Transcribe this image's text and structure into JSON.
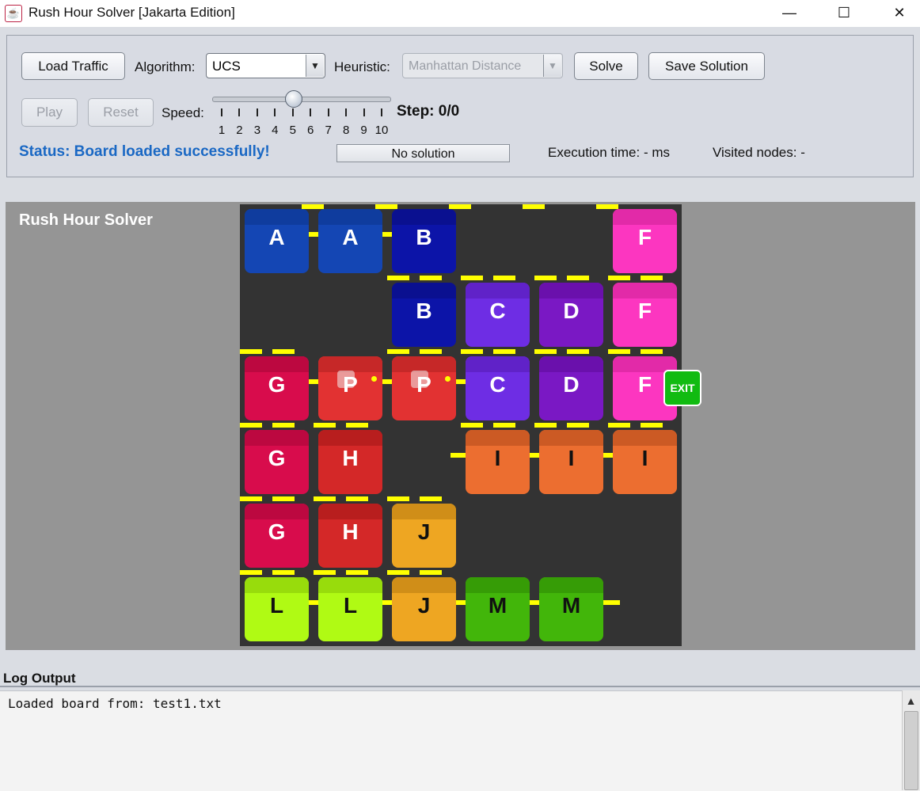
{
  "window": {
    "title": "Rush Hour Solver [Jakarta Edition]",
    "icon": "java-cup-icon"
  },
  "window_controls": {
    "minimize": "—",
    "maximize": "☐",
    "close": "✕"
  },
  "toolbar": {
    "load_label": "Load Traffic",
    "algorithm_label": "Algorithm:",
    "algorithm_value": "UCS",
    "heuristic_label": "Heuristic:",
    "heuristic_value": "Manhattan Distance",
    "solve_label": "Solve",
    "save_label": "Save Solution",
    "play_label": "Play",
    "reset_label": "Reset",
    "speed_label": "Speed:",
    "speed_ticks": [
      "1",
      "2",
      "3",
      "4",
      "5",
      "6",
      "7",
      "8",
      "9",
      "10"
    ],
    "speed_value": 5,
    "step": "Step: 0/0",
    "status": "Status: Board loaded successfully!",
    "progress_text": "No solution",
    "exec_time": "Execution time: - ms",
    "visited_nodes": "Visited nodes: -"
  },
  "board": {
    "title": "Rush Hour Solver",
    "exit_label": "EXIT",
    "rows": 6,
    "cols": 6,
    "pieces": [
      {
        "id": "A",
        "cells": [
          [
            0,
            0
          ],
          [
            0,
            1
          ]
        ],
        "color": "#1446b4",
        "top": "#0f3c9e",
        "text": "#ffffff"
      },
      {
        "id": "B",
        "cells": [
          [
            0,
            2
          ],
          [
            1,
            2
          ]
        ],
        "color": "#0c14a8",
        "top": "#0a1090",
        "text": "#ffffff"
      },
      {
        "id": "F",
        "cells": [
          [
            0,
            5
          ],
          [
            1,
            5
          ],
          [
            2,
            5
          ]
        ],
        "color": "#fc36c0",
        "top": "#e22aa8",
        "text": "#ffffff"
      },
      {
        "id": "C",
        "cells": [
          [
            1,
            3
          ],
          [
            2,
            3
          ]
        ],
        "color": "#6e2de4",
        "top": "#6022c8",
        "text": "#ffffff"
      },
      {
        "id": "D",
        "cells": [
          [
            1,
            4
          ],
          [
            2,
            4
          ]
        ],
        "color": "#7a18c4",
        "top": "#6a10ac",
        "text": "#ffffff"
      },
      {
        "id": "G",
        "cells": [
          [
            2,
            0
          ],
          [
            3,
            0
          ],
          [
            4,
            0
          ]
        ],
        "color": "#d80c4c",
        "top": "#bc0840",
        "text": "#ffffff"
      },
      {
        "id": "P",
        "cells": [
          [
            2,
            1
          ],
          [
            2,
            2
          ]
        ],
        "color": "#e23232",
        "top": "#c62828",
        "text": "#ffffff",
        "primary": true
      },
      {
        "id": "H",
        "cells": [
          [
            3,
            1
          ],
          [
            4,
            1
          ]
        ],
        "color": "#d42828",
        "top": "#b81e1e",
        "text": "#ffffff"
      },
      {
        "id": "I",
        "cells": [
          [
            3,
            3
          ],
          [
            3,
            4
          ],
          [
            3,
            5
          ]
        ],
        "color": "#ec6e30",
        "top": "#cc5a24",
        "text": "#111111"
      },
      {
        "id": "J",
        "cells": [
          [
            4,
            2
          ],
          [
            5,
            2
          ]
        ],
        "color": "#eea622",
        "top": "#d08e18",
        "text": "#111111"
      },
      {
        "id": "L",
        "cells": [
          [
            5,
            0
          ],
          [
            5,
            1
          ]
        ],
        "color": "#b0fa14",
        "top": "#98dc0c",
        "text": "#111111"
      },
      {
        "id": "M",
        "cells": [
          [
            5,
            3
          ],
          [
            5,
            4
          ]
        ],
        "color": "#42b60a",
        "top": "#369c06",
        "text": "#111111"
      }
    ]
  },
  "log": {
    "label": "Log Output",
    "text": "Loaded board from: test1.txt"
  }
}
